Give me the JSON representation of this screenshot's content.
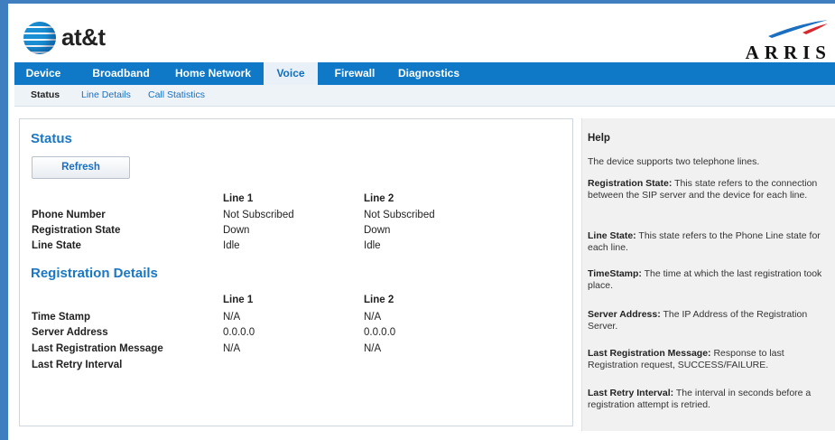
{
  "header": {
    "brand_left": "at&t",
    "brand_right": "ARRIS"
  },
  "nav": {
    "tabs": [
      {
        "label": "Device",
        "active": false
      },
      {
        "label": "Broadband",
        "active": false
      },
      {
        "label": "Home Network",
        "active": false
      },
      {
        "label": "Voice",
        "active": true
      },
      {
        "label": "Firewall",
        "active": false
      },
      {
        "label": "Diagnostics",
        "active": false
      }
    ]
  },
  "subnav": {
    "items": [
      {
        "label": "Status",
        "active": true
      },
      {
        "label": "Line Details",
        "active": false
      },
      {
        "label": "Call Statistics",
        "active": false
      }
    ]
  },
  "status": {
    "title": "Status",
    "refresh_label": "Refresh",
    "col1": "Line 1",
    "col2": "Line 2",
    "rows": [
      {
        "label": "Phone Number",
        "line1": "Not Subscribed",
        "line2": "Not Subscribed"
      },
      {
        "label": "Registration State",
        "line1": "Down",
        "line2": "Down"
      },
      {
        "label": "Line State",
        "line1": "Idle",
        "line2": "Idle"
      }
    ]
  },
  "registration": {
    "title": "Registration Details",
    "col1": "Line 1",
    "col2": "Line 2",
    "rows": [
      {
        "label": "Time Stamp",
        "line1": "N/A",
        "line2": "N/A"
      },
      {
        "label": "Server Address",
        "line1": "0.0.0.0",
        "line2": "0.0.0.0"
      },
      {
        "label": "Last Registration Message",
        "line1": "N/A",
        "line2": "N/A"
      },
      {
        "label": "Last Retry Interval",
        "line1": "",
        "line2": ""
      }
    ]
  },
  "help": {
    "title": "Help",
    "intro": "The device supports two telephone lines.",
    "items": [
      {
        "term": "Registration State:",
        "text": " This state refers to the connection between the SIP server and the device for each line."
      },
      {
        "term": "Line State:",
        "text": " This state refers to the Phone Line state for each line."
      },
      {
        "term": "TimeStamp:",
        "text": " The time at which the last registration took place."
      },
      {
        "term": "Server Address:",
        "text": " The IP Address of the Registration Server."
      },
      {
        "term": "Last Registration Message:",
        "text": " Response to last Registration request, SUCCESS/FAILURE."
      },
      {
        "term": "Last Retry Interval:",
        "text": " The interval in seconds before a registration attempt is retried."
      }
    ]
  },
  "colors": {
    "nav_blue": "#0f79c8",
    "link_blue": "#1a77c4",
    "frame_blue": "#3f7fbf"
  }
}
